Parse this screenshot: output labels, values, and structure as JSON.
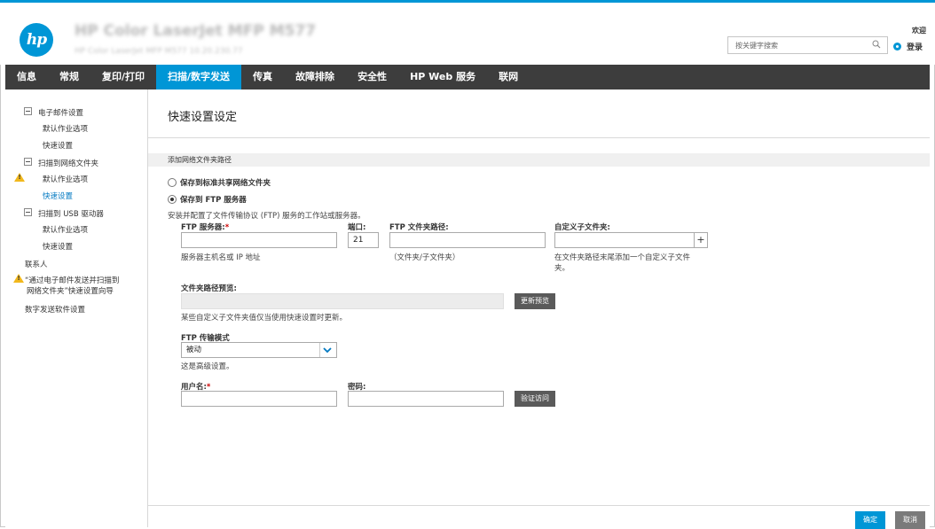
{
  "header": {
    "printer_name": "HP Color LaserJet MFP M577",
    "printer_sub": "HP Color LaserJet MFP M577   10.20.230.77",
    "search_placeholder": "按关键字搜索",
    "welcome": "欢迎",
    "login": "登录"
  },
  "nav": {
    "items": [
      "信息",
      "常规",
      "复印/打印",
      "扫描/数字发送",
      "传真",
      "故障排除",
      "安全性",
      "HP Web 服务",
      "联网"
    ],
    "active_index": 3
  },
  "sidebar": {
    "email_setup": "电子邮件设置",
    "email_default_options": "默认作业选项",
    "email_quick_sets": "快速设置",
    "scan_network_folder": "扫描到网络文件夹",
    "folder_default_options": "默认作业选项",
    "folder_quick_sets": "快速设置",
    "scan_usb": "扫描到 USB 驱动器",
    "usb_default_options": "默认作业选项",
    "usb_quick_sets": "快速设置",
    "contacts": "联系人",
    "wizard_line1": "“通过电子邮件发送并扫描到",
    "wizard_line2": "网络文件夹”快速设置向导",
    "digital_sending_software": "数字发送软件设置"
  },
  "main": {
    "title": "快速设置设定",
    "section": "添加网络文件夹路径",
    "radio_shared": "保存到标准共享网络文件夹",
    "radio_ftp": "保存到 FTP 服务器",
    "ftp_desc": "安装并配置了文件传输协议 (FTP) 服务的工作站或服务器。",
    "ftp_server_label": "FTP 服务器:",
    "ftp_server_value": "",
    "ftp_server_hint": "服务器主机名或 IP 地址",
    "port_label": "端口:",
    "port_value": "21",
    "ftp_path_label": "FTP 文件夹路径:",
    "ftp_path_value": "",
    "ftp_path_hint": "（文件夹/子文件夹）",
    "custom_subfolder_label": "自定义子文件夹:",
    "custom_subfolder_value": "",
    "custom_subfolder_hint_line1": "在文件夹路径末尾添加一个自定义子文件",
    "custom_subfolder_hint_line2": "夹。",
    "plus": "+",
    "preview_label": "文件夹路径预览:",
    "preview_value": "",
    "update_preview": "更新预览",
    "preview_note": "某些自定义子文件夹值仅当使用快速设置时更新。",
    "transfer_mode_label": "FTP 传输模式",
    "transfer_mode_value": "被动",
    "advanced_note": "这是高级设置。",
    "username_label": "用户名:",
    "username_value": "",
    "password_label": "密码:",
    "password_value": "",
    "verify_access": "验证访问",
    "required_mark": "*"
  },
  "footer": {
    "ok": "确定",
    "cancel": "取消"
  },
  "colors": {
    "accent": "#0096d6",
    "nav_bg": "#3d3d3d",
    "warning": "#f2b81c"
  },
  "icons": [
    "hp-logo",
    "search-icon",
    "user-icon",
    "collapse-icon",
    "warning-icon",
    "chevron-down-icon"
  ]
}
